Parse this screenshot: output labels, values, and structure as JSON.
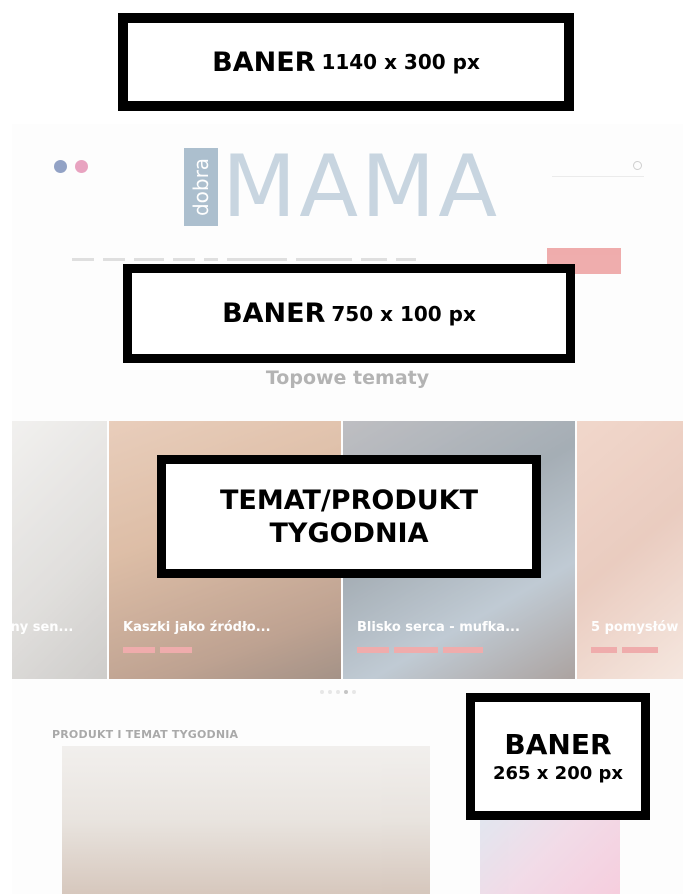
{
  "banners": {
    "top": {
      "label": "BANER",
      "size": "1140 x 300 px"
    },
    "middle": {
      "label": "BANER",
      "size": "750 x 100 px"
    },
    "featured": {
      "line1": "TEMAT/PRODUKT",
      "line2": "TYGODNIA"
    },
    "side": {
      "label": "BANER",
      "size": "265 x 200 px"
    }
  },
  "site": {
    "logo": {
      "small": "dobra",
      "main": "MAMA"
    },
    "section_title": "Topowe tematy",
    "carousel": [
      {
        "caption": "jny sen..."
      },
      {
        "caption": "Kaszki jako źródło..."
      },
      {
        "caption": "Blisko serca - mufka..."
      },
      {
        "caption": "5 pomysłów"
      }
    ],
    "widget_title": "PRODUKT I TEMAT TYGODNIA"
  },
  "colors": {
    "accent": "#e46b6b",
    "logo_block": "#6a8ea8",
    "logo_text": "#9db6c9",
    "banner_border": "#000000"
  }
}
